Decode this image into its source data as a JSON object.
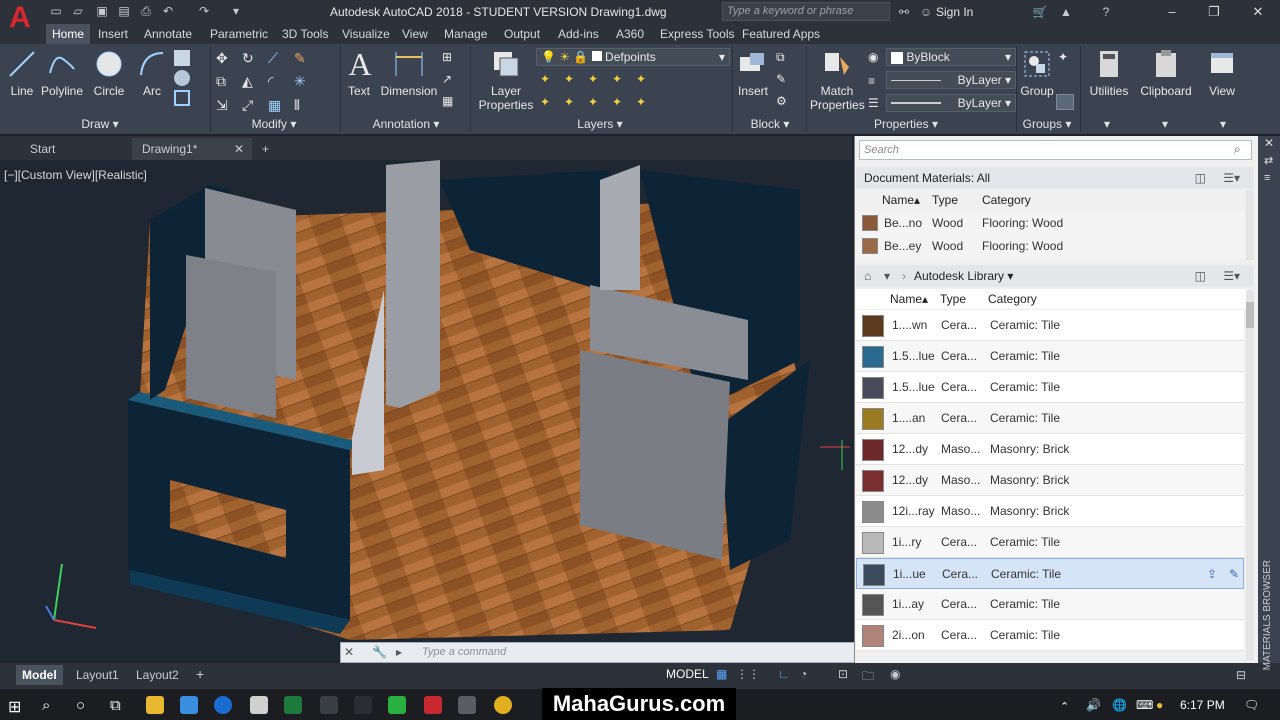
{
  "app": {
    "logo": "A",
    "title": "Autodesk AutoCAD 2018 - STUDENT VERSION    Drawing1.dwg"
  },
  "search": {
    "placeholder": "Type a keyword or phrase"
  },
  "account": {
    "signin": "Sign In"
  },
  "ribbon_tabs": [
    "Home",
    "Insert",
    "Annotate",
    "Parametric",
    "3D Tools",
    "Visualize",
    "View",
    "Manage",
    "Output",
    "Add-ins",
    "A360",
    "Express Tools",
    "Featured Apps"
  ],
  "draw": {
    "line": "Line",
    "polyline": "Polyline",
    "circle": "Circle",
    "arc": "Arc",
    "title": "Draw"
  },
  "modify": {
    "title": "Modify"
  },
  "annotation": {
    "text": "Text",
    "dimension": "Dimension",
    "title": "Annotation"
  },
  "layers": {
    "layer_properties_1": "Layer",
    "layer_properties_2": "Properties",
    "current_layer": "Defpoints",
    "title": "Layers"
  },
  "block": {
    "insert": "Insert",
    "title": "Block"
  },
  "properties": {
    "match_1": "Match",
    "match_2": "Properties",
    "color": "ByBlock",
    "linetype": "ByLayer",
    "lineweight": "ByLayer",
    "title": "Properties"
  },
  "groups": {
    "group": "Group",
    "title": "Groups"
  },
  "utilities": {
    "label": "Utilities"
  },
  "clipboard": {
    "label": "Clipboard"
  },
  "view_panel": {
    "label": "View"
  },
  "file_tabs": {
    "start": "Start",
    "drawing": "Drawing1*"
  },
  "viewport": {
    "label": "[−][Custom View][Realistic]"
  },
  "command": {
    "placeholder": "Type a command"
  },
  "layout_tabs": [
    "Model",
    "Layout1",
    "Layout2"
  ],
  "status": {
    "model": "MODEL"
  },
  "materials": {
    "search_placeholder": "Search",
    "doc_header": "Document Materials: All",
    "columns": {
      "name": "Name",
      "type": "Type",
      "category": "Category"
    },
    "doc_rows": [
      {
        "name": "Be...no",
        "type": "Wood",
        "category": "Flooring: Wood",
        "color": "#8a5a3a"
      },
      {
        "name": "Be...ey",
        "type": "Wood",
        "category": "Flooring: Wood",
        "color": "#9a6a48"
      }
    ],
    "library_header": "Autodesk Library",
    "lib_rows": [
      {
        "name": "1....wn",
        "type": "Cera...",
        "category": "Ceramic: Tile",
        "color": "#5e3a1f"
      },
      {
        "name": "1.5...lue",
        "type": "Cera...",
        "category": "Ceramic: Tile",
        "color": "#2a6a8e"
      },
      {
        "name": "1.5...lue",
        "type": "Cera...",
        "category": "Ceramic: Tile",
        "color": "#4a4a5a"
      },
      {
        "name": "1....an",
        "type": "Cera...",
        "category": "Ceramic: Tile",
        "color": "#9a7a22"
      },
      {
        "name": "12...dy",
        "type": "Maso...",
        "category": "Masonry: Brick",
        "color": "#6e2a2a"
      },
      {
        "name": "12...dy",
        "type": "Maso...",
        "category": "Masonry: Brick",
        "color": "#7a2e30"
      },
      {
        "name": "12i...ray",
        "type": "Maso...",
        "category": "Masonry: Brick",
        "color": "#8c8c8c"
      },
      {
        "name": "1i...ry",
        "type": "Cera...",
        "category": "Ceramic: Tile",
        "color": "#b9b9b9"
      },
      {
        "name": "1i...ue",
        "type": "Cera...",
        "category": "Ceramic: Tile",
        "color": "#3c4a5e"
      },
      {
        "name": "1i...ay",
        "type": "Cera...",
        "category": "Ceramic: Tile",
        "color": "#555555"
      },
      {
        "name": "2i...on",
        "type": "Cera...",
        "category": "Ceramic: Tile",
        "color": "#b08478"
      }
    ],
    "side_label": "MATERIALS BROWSER"
  },
  "watermark": "MahaGurus.com",
  "clock": "6:17 PM"
}
